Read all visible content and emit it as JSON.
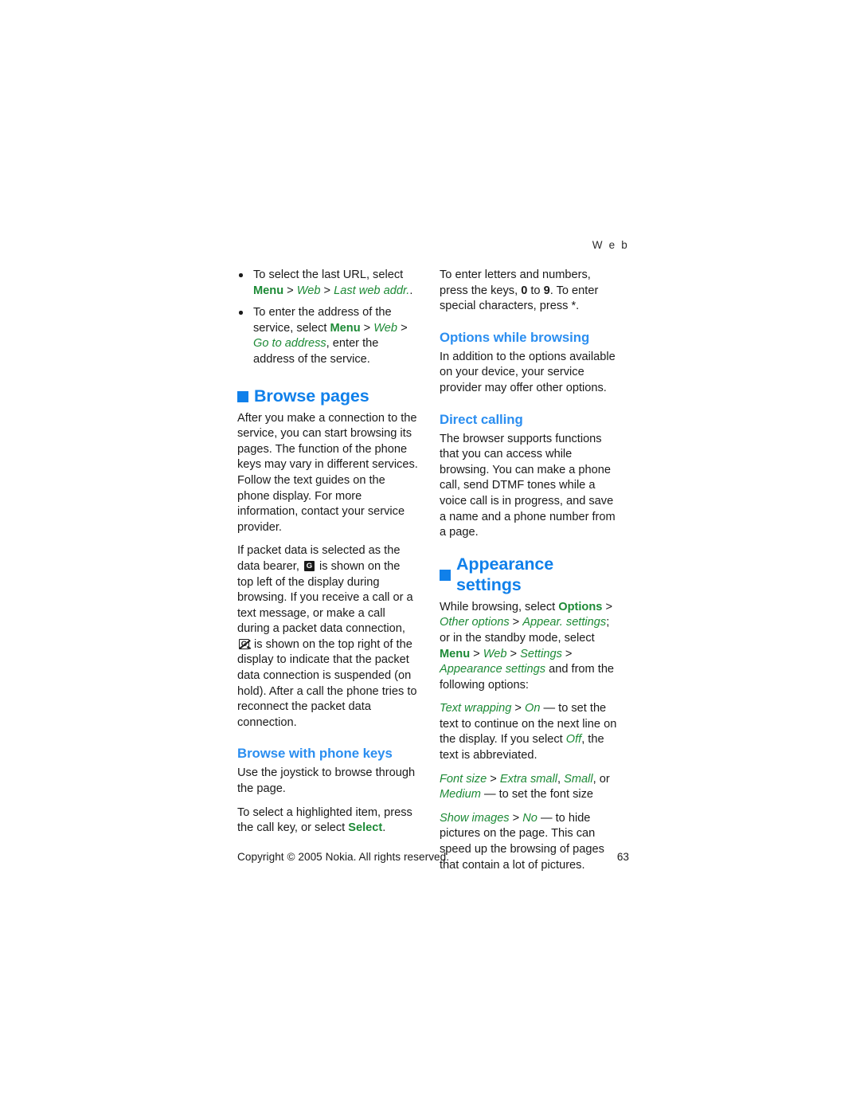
{
  "header": {
    "running_title": "W e b"
  },
  "colors": {
    "heading_blue": "#1080ea",
    "subheading_blue": "#2b8ef0",
    "menu_green": "#1d8a36",
    "body_black": "#1a1a1a"
  },
  "left_column": {
    "bullets": [
      {
        "pre": "To select the last URL, select ",
        "menu": "Menu",
        "sep1": " > ",
        "path1": "Web",
        "sep2": " > ",
        "path2": "Last web addr.",
        "post": "."
      },
      {
        "pre": "To enter the address of the service, select ",
        "menu": "Menu",
        "sep1": " > ",
        "path1": "Web",
        "sep2": " > ",
        "path2": "Go to address",
        "post": ", enter the address of the service."
      }
    ],
    "browse_pages_heading": "Browse pages",
    "browse_pages_p1": "After you make a connection to the service, you can start browsing its pages. The function of the phone keys may vary in different services. Follow the text guides on the phone display. For more information, contact your service provider.",
    "packet_data": {
      "part1": "If packet data is selected as the data bearer, ",
      "icon1_name": "gprs-indicator-icon",
      "icon1_glyph": "G",
      "part2": " is shown on the top left of the display during browsing. If you receive a call or a text message, or make a call during a packet data connection, ",
      "icon2_name": "gprs-suspended-indicator-icon",
      "icon2_glyph": "G",
      "part3": " is shown on the top right of the display to indicate that the packet data connection is suspended (on hold). After a call the phone tries to reconnect the packet data connection."
    },
    "browse_keys_heading": "Browse with phone keys",
    "browse_keys_p1": "Use the joystick to browse through the page.",
    "browse_keys_p2_pre": "To select a highlighted item, press the call key, or select ",
    "browse_keys_p2_select": "Select",
    "browse_keys_p2_post": "."
  },
  "right_column": {
    "enter_letters": {
      "part1": "To enter letters and numbers, press the keys, ",
      "key_zero": "0",
      "part2": " to ",
      "key_nine": "9",
      "part3": ". To enter special characters, press *."
    },
    "options_heading": "Options while browsing",
    "options_p1": "In addition to the options available on your device, your service provider may offer other options.",
    "direct_calling_heading": "Direct calling",
    "direct_calling_p1": "The browser supports functions that you can access while browsing. You can make a phone call, send DTMF tones while a voice call is in progress, and save a name and a phone number from a page.",
    "appearance_heading": "Appearance settings",
    "appearance_intro": {
      "p1": "While browsing, select ",
      "options": "Options",
      "s1": " > ",
      "other_options": "Other options",
      "s2": " > ",
      "appear_settings": "Appear. settings",
      "p2": "; or in the standby mode, select ",
      "menu": "Menu",
      "s3": " > ",
      "web": "Web",
      "s4": " > ",
      "settings": "Settings",
      "s5": " > ",
      "appearance_settings": "Appearance settings",
      "p3": " and from the following options:"
    },
    "option_items": [
      {
        "name": "Text wrapping",
        "sep": " > ",
        "value": "On",
        "dash": " — to set the text to continue on the next line on the display. If you select ",
        "value2": "Off",
        "tail": ", the text is abbreviated."
      },
      {
        "name": "Font size",
        "sep": " > ",
        "value": "Extra small",
        "value_sep1": ", ",
        "value2": "Small",
        "value_sep2": ", or ",
        "value3": "Medium",
        "dash": " — to set the font size"
      },
      {
        "name": "Show images",
        "sep": " > ",
        "value": "No",
        "dash": " — to hide pictures on the page. This can speed up the browsing of pages that contain a lot of pictures."
      }
    ]
  },
  "footer": {
    "copyright": "Copyright © 2005 Nokia. All rights reserved.",
    "page_number": "63"
  }
}
